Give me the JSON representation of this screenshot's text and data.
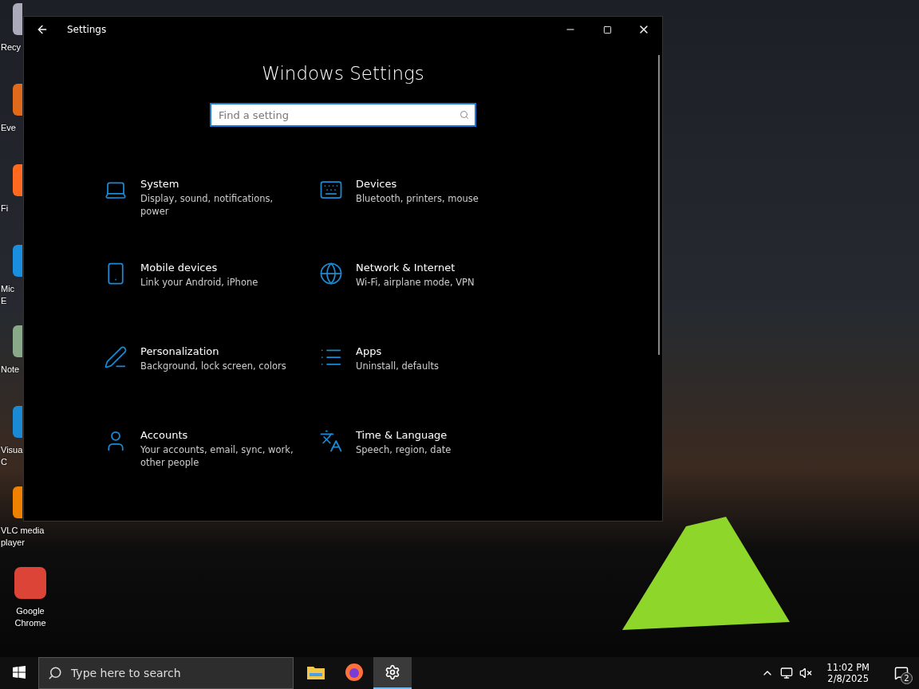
{
  "desktop_icons": [
    {
      "label": "Recy",
      "covered": true
    },
    {
      "label": "Eve",
      "covered": true
    },
    {
      "label": "Fi",
      "covered": true
    },
    {
      "label": "Mic\nE",
      "covered": true
    },
    {
      "label": "Note",
      "covered": true
    },
    {
      "label": "Visua\nC",
      "covered": true
    },
    {
      "label": "VLC media\nplayer",
      "covered": true
    },
    {
      "label": "Google\nChrome",
      "covered": false
    }
  ],
  "window": {
    "title": "Settings",
    "heading": "Windows Settings",
    "search": {
      "placeholder": "Find a setting"
    },
    "categories": [
      {
        "title": "System",
        "subtitle": "Display, sound, notifications, power"
      },
      {
        "title": "Devices",
        "subtitle": "Bluetooth, printers, mouse"
      },
      {
        "title": "Mobile devices",
        "subtitle": "Link your Android, iPhone"
      },
      {
        "title": "Network & Internet",
        "subtitle": "Wi-Fi, airplane mode, VPN"
      },
      {
        "title": "Personalization",
        "subtitle": "Background, lock screen, colors"
      },
      {
        "title": "Apps",
        "subtitle": "Uninstall, defaults"
      },
      {
        "title": "Accounts",
        "subtitle": "Your accounts, email, sync, work, other people"
      },
      {
        "title": "Time & Language",
        "subtitle": "Speech, region, date"
      }
    ]
  },
  "taskbar": {
    "search": {
      "placeholder": "Type here to search"
    },
    "apps": [
      {
        "selected": false
      },
      {
        "selected": false
      },
      {
        "selected": true
      }
    ],
    "time": "11:02 PM",
    "date": "2/8/2025",
    "notification_count": "2"
  }
}
